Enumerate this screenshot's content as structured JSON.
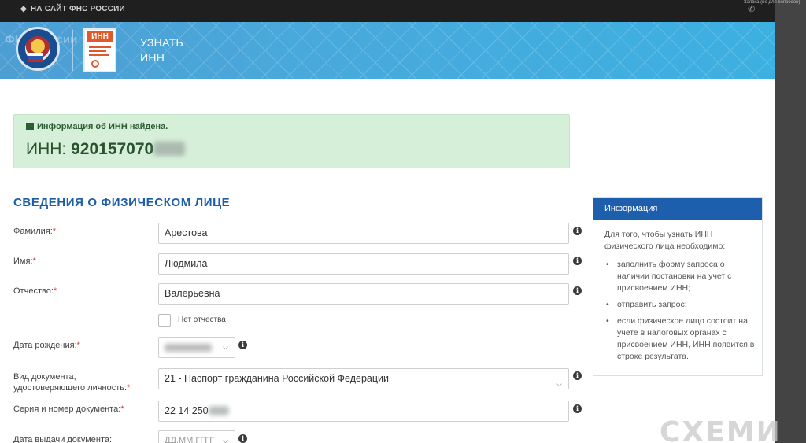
{
  "topbar": {
    "back_link": "НА САЙТ ФНС РОССИИ",
    "right_text": "Заявка (не для вопросов)"
  },
  "banner": {
    "logo_text": "ФНС России",
    "inn_badge": "ИНН",
    "title_line1": "УЗНАТЬ",
    "title_line2": "ИНН"
  },
  "success": {
    "message": "Информация об ИНН найдена.",
    "inn_label": "ИНН:",
    "inn_value": "920157070"
  },
  "form": {
    "section_title": "СВЕДЕНИЯ О ФИЗИЧЕСКОМ ЛИЦЕ",
    "surname_label": "Фамилия:",
    "surname_value": "Арестова",
    "name_label": "Имя:",
    "name_value": "Людмила",
    "patronymic_label": "Отчество:",
    "patronymic_value": "Валерьевна",
    "no_patronymic_label": "Нет отчества",
    "birth_label": "Дата рождения:",
    "doc_type_label_1": "Вид документа,",
    "doc_type_label_2": "удостоверяющего личность:",
    "doc_type_value": "21 - Паспорт гражданина Российской Федерации",
    "doc_number_label": "Серия и номер документа:",
    "doc_number_value": "22 14 250",
    "issue_date_label": "Дата выдачи документа:",
    "issue_date_placeholder": "ДД.ММ.ГГГГ",
    "required_mark": "*"
  },
  "info_panel": {
    "title": "Информация",
    "intro": "Для того, чтобы узнать ИНН физического лица необходимо:",
    "items": [
      "заполнить форму запроса о наличии постановки на учет с присвоением ИНН;",
      "отправить запрос;",
      "если физическое лицо состоит на учете в налоговых органах с присвоением ИНН, ИНН появится в строке результата."
    ]
  },
  "watermark": "СХЕМИ",
  "colors": {
    "brand_blue": "#1d5fad",
    "banner_blue": "#49a9dc",
    "success_bg": "#d6efd9",
    "required": "#d32f2f"
  },
  "icons": [
    "arrow-left-icon",
    "phone-icon",
    "fns-emblem-icon",
    "inn-document-icon",
    "gift-icon",
    "info-icon",
    "chevron-down-icon"
  ]
}
